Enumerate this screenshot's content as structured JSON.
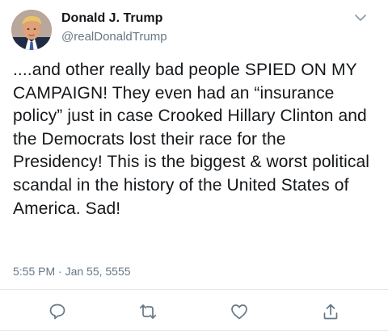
{
  "author": {
    "display_name": "Donald J. Trump",
    "handle": "@realDonaldTrump"
  },
  "tweet": {
    "text": "....and other really bad people SPIED ON MY CAMPAIGN! They even had an “insurance policy” just in case Crooked Hillary Clinton and the Democrats lost their race for the Presidency! This is the biggest & worst political scandal in the history of the United States of America. Sad!",
    "timestamp": "5:55 PM · Jan 55, 5555"
  },
  "icons": {
    "more": "chevron-down-icon",
    "reply": "reply-icon",
    "retweet": "retweet-icon",
    "like": "heart-icon",
    "share": "share-icon"
  },
  "colors": {
    "text": "#14171a",
    "secondary": "#657786",
    "icon": "#657786",
    "divider": "#e1e8ed"
  }
}
